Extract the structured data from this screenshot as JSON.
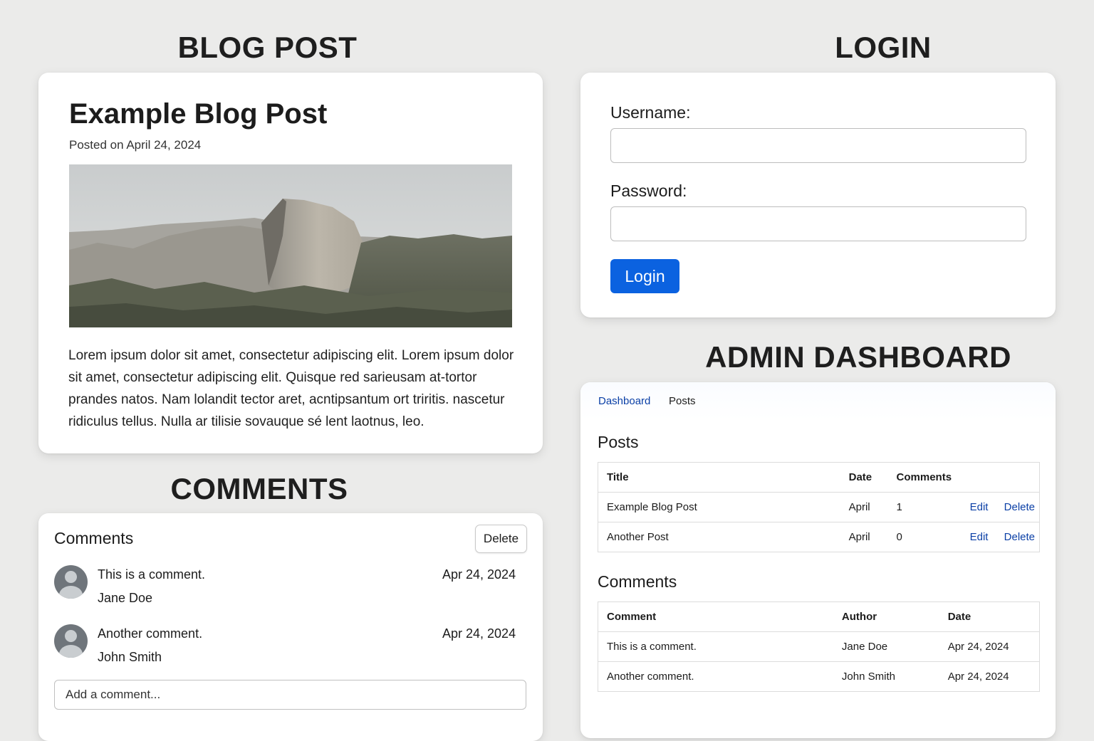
{
  "sections": {
    "blog": "BLOG POST",
    "comments": "COMMENTS",
    "login": "LOGIN",
    "admin": "ADMIN DASHBOARD"
  },
  "blog": {
    "title": "Example Blog Post",
    "date": "Posted on April 24, 2024",
    "body": "Lorem ipsum dolor sit amet, consectetur adipiscing elit. Lorem ipsum dolor sit amet, consectetur adipiscing elit. Quisque red sarieusam at-tortor prandes natos. Nam lolandit tector aret, acntipsantum ort triritis. nascetur ridiculus tellus. Nulla ar tilisie sovauque sé lent laotnus, leo."
  },
  "comments": {
    "title": "Comments",
    "delete_label": "Delete",
    "items": [
      {
        "text": "This is a comment.",
        "author": "Jane Doe",
        "date": "Apr 24, 2024"
      },
      {
        "text": "Another comment.",
        "author": "John Smith",
        "date": "Apr 24, 2024"
      }
    ],
    "input_placeholder": "Add a comment..."
  },
  "login": {
    "username_label": "Username:",
    "password_label": "Password:",
    "button_label": "Login"
  },
  "admin": {
    "nav": [
      "Dashboard",
      "Posts"
    ],
    "posts_title": "Posts",
    "posts_headers": [
      "Title",
      "Date",
      "Comments"
    ],
    "posts_rows": [
      {
        "title": "Example Blog Post",
        "date": "April",
        "comments": "1",
        "edit": "Edit",
        "delete": "Delete"
      },
      {
        "title": "Another Post",
        "date": "April",
        "comments": "0",
        "edit": "Edit",
        "delete": "Delete"
      }
    ],
    "comments_title": "Comments",
    "comments_headers": [
      "Comment",
      "Author",
      "Date"
    ],
    "comments_rows": [
      {
        "comment": "This is a comment.",
        "author": "Jane Doe",
        "date": "Apr 24, 2024"
      },
      {
        "comment": "Another comment.",
        "author": "John Smith",
        "date": "Apr 24, 2024"
      }
    ]
  },
  "colors": {
    "page_bg": "#ebebea",
    "link": "#0a3fa6",
    "primary_button": "#0b62e0"
  },
  "icons": {
    "avatar": "user-avatar-icon"
  }
}
